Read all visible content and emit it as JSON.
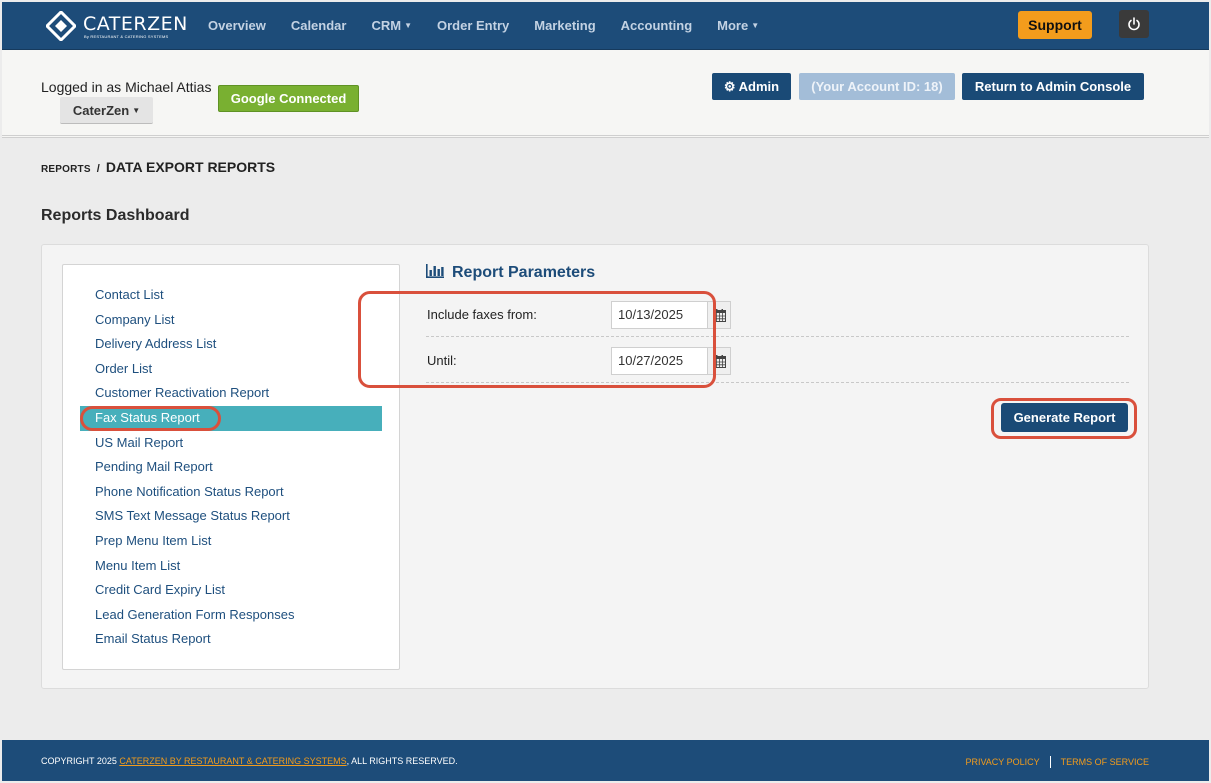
{
  "brand": {
    "name": "CATERZEN",
    "tagline": "By RESTAURANT & CATERING SYSTEMS"
  },
  "nav": {
    "items": [
      {
        "label": "Overview",
        "dropdown": false
      },
      {
        "label": "Calendar",
        "dropdown": false
      },
      {
        "label": "CRM",
        "dropdown": true
      },
      {
        "label": "Order Entry",
        "dropdown": false
      },
      {
        "label": "Marketing",
        "dropdown": false
      },
      {
        "label": "Accounting",
        "dropdown": false
      },
      {
        "label": "More",
        "dropdown": true
      }
    ],
    "support_label": "Support"
  },
  "header": {
    "logged_in_text": "Logged in as Michael Attias",
    "account_label": "CaterZen",
    "google_label": "Google Connected",
    "admin_label": "Admin",
    "account_id_label": "(Your Account ID: 18)",
    "return_label": "Return to Admin Console"
  },
  "breadcrumb": {
    "root": "REPORTS",
    "separator": "/",
    "current": "DATA EXPORT REPORTS"
  },
  "page_title": "Reports Dashboard",
  "reports": {
    "active_index": 5,
    "items": [
      "Contact List",
      "Company List",
      "Delivery Address List",
      "Order List",
      "Customer Reactivation Report",
      "Fax Status Report",
      "US Mail Report",
      "Pending Mail Report",
      "Phone Notification Status Report",
      "SMS Text Message Status Report",
      "Prep Menu Item List",
      "Menu Item List",
      "Credit Card Expiry List",
      "Lead Generation Form Responses",
      "Email Status Report"
    ]
  },
  "params": {
    "title": "Report Parameters",
    "from_label": "Include faxes from:",
    "from_value": "10/13/2025",
    "until_label": "Until:",
    "until_value": "10/27/2025",
    "generate_label": "Generate Report"
  },
  "footer": {
    "copyright_prefix": "COPYRIGHT 2025 ",
    "copyright_link": "CATERZEN BY RESTAURANT & CATERING SYSTEMS",
    "copyright_suffix": ", ALL RIGHTS RESERVED.",
    "privacy_label": "PRIVACY POLICY",
    "terms_label": "TERMS OF SERVICE"
  },
  "colors": {
    "nav_bg": "#1d4c79",
    "support": "#f39c1c",
    "google": "#79b031",
    "active_row": "#47afbb",
    "annotation": "#d9503c"
  }
}
